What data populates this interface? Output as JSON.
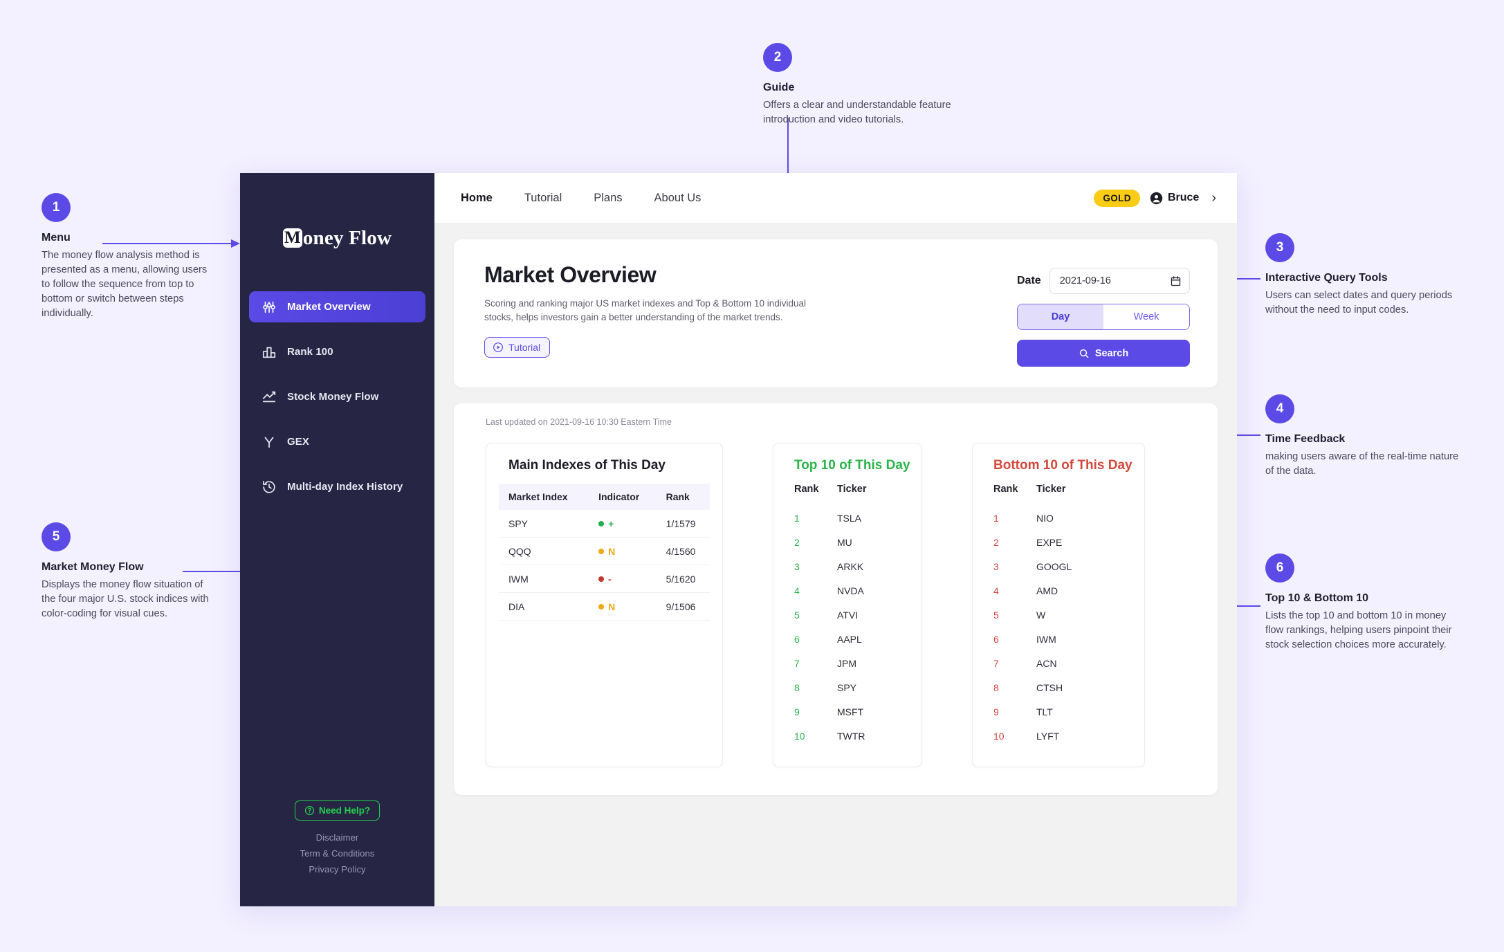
{
  "app": {
    "logo": {
      "mark": "M",
      "text": "oney Flow"
    },
    "sidebar": {
      "items": [
        {
          "label": "Market Overview",
          "icon": "sliders-icon",
          "active": true
        },
        {
          "label": "Rank 100",
          "icon": "bar-chart-icon",
          "active": false
        },
        {
          "label": "Stock Money Flow",
          "icon": "trending-up-icon",
          "active": false
        },
        {
          "label": "GEX",
          "icon": "gamma-icon",
          "active": false
        },
        {
          "label": "Multi-day Index History",
          "icon": "clock-rewind-icon",
          "active": false
        }
      ],
      "need_help": "Need Help?",
      "links": [
        "Disclaimer",
        "Term & Conditions",
        "Privacy Policy"
      ]
    },
    "topnav": {
      "items": [
        "Home",
        "Tutorial",
        "Plans",
        "About Us"
      ],
      "active": "Home",
      "plan_badge": "GOLD",
      "user_name": "Bruce"
    },
    "overview": {
      "title": "Market Overview",
      "description": "Scoring and ranking major US market indexes and Top & Bottom 10 individual stocks, helps investors gain a better understanding of the market trends.",
      "tutorial_label": "Tutorial",
      "date_label": "Date",
      "date_value": "2021-09-16",
      "period_options": [
        "Day",
        "Week"
      ],
      "period_selected": "Day",
      "search_label": "Search"
    },
    "data": {
      "last_updated": "Last updated on 2021-09-16 10:30 Eastern Time",
      "main_indexes": {
        "title": "Main Indexes of This Day",
        "columns": [
          "Market Index",
          "Indicator",
          "Rank"
        ],
        "rows": [
          {
            "index": "SPY",
            "indicator": "+",
            "indicator_color": "#22b14c",
            "rank": "1/1579"
          },
          {
            "index": "QQQ",
            "indicator": "N",
            "indicator_color": "#f0a818",
            "rank": "4/1560"
          },
          {
            "index": "IWM",
            "indicator": "-",
            "indicator_color": "#c0392b",
            "rank": "5/1620"
          },
          {
            "index": "DIA",
            "indicator": "N",
            "indicator_color": "#f0a818",
            "rank": "9/1506"
          }
        ]
      },
      "top10": {
        "title": "Top 10 of This Day",
        "columns": [
          "Rank",
          "Ticker"
        ],
        "rows": [
          {
            "rank": "1",
            "ticker": "TSLA"
          },
          {
            "rank": "2",
            "ticker": "MU"
          },
          {
            "rank": "3",
            "ticker": "ARKK"
          },
          {
            "rank": "4",
            "ticker": "NVDA"
          },
          {
            "rank": "5",
            "ticker": "ATVI"
          },
          {
            "rank": "6",
            "ticker": "AAPL"
          },
          {
            "rank": "7",
            "ticker": "JPM"
          },
          {
            "rank": "8",
            "ticker": "SPY"
          },
          {
            "rank": "9",
            "ticker": "MSFT"
          },
          {
            "rank": "10",
            "ticker": "TWTR"
          }
        ]
      },
      "bottom10": {
        "title": "Bottom 10 of This Day",
        "columns": [
          "Rank",
          "Ticker"
        ],
        "rows": [
          {
            "rank": "1",
            "ticker": "NIO"
          },
          {
            "rank": "2",
            "ticker": "EXPE"
          },
          {
            "rank": "3",
            "ticker": "GOOGL"
          },
          {
            "rank": "4",
            "ticker": "AMD"
          },
          {
            "rank": "5",
            "ticker": "W"
          },
          {
            "rank": "6",
            "ticker": "IWM"
          },
          {
            "rank": "7",
            "ticker": "ACN"
          },
          {
            "rank": "8",
            "ticker": "CTSH"
          },
          {
            "rank": "9",
            "ticker": "TLT"
          },
          {
            "rank": "10",
            "ticker": "LYFT"
          }
        ]
      }
    }
  },
  "annotations": [
    {
      "number": "1",
      "title": "Menu",
      "body": "The money flow analysis method is presented as a menu, allowing users to follow the sequence from top to bottom or switch between steps individually."
    },
    {
      "number": "2",
      "title": "Guide",
      "body": "Offers a clear and understandable feature introduction and video tutorials."
    },
    {
      "number": "3",
      "title": "Interactive Query Tools",
      "body": "Users can select dates and query periods without the need to input codes."
    },
    {
      "number": "4",
      "title": "Time Feedback",
      "body": "making users aware of the real-time nature of the data."
    },
    {
      "number": "5",
      "title": "Market Money Flow",
      "body": "Displays the money flow situation of the four major U.S. stock indices with color-coding for visual cues."
    },
    {
      "number": "6",
      "title": "Top 10 & Bottom 10",
      "body": "Lists the top 10 and bottom 10 in money flow rankings, helping users pinpoint their stock selection choices more accurately."
    }
  ],
  "colors": {
    "accent": "#5b4ae6",
    "sidebar": "#262544",
    "gold": "#facc15",
    "green": "#2bb34a",
    "red": "#d4483c",
    "page_bg": "#f3f0ff"
  }
}
